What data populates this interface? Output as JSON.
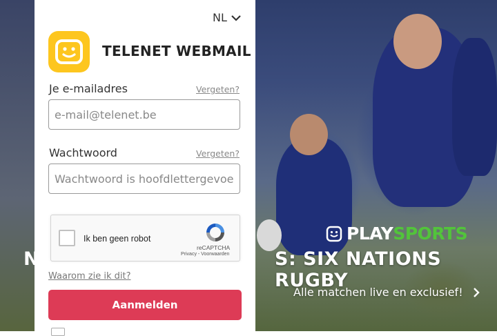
{
  "language": {
    "selected": "NL"
  },
  "brand": {
    "name": "TELENET WEBMAIL",
    "color": "#fdc61f"
  },
  "email": {
    "label": "Je e-mailadres",
    "forgot": "Vergeten?",
    "placeholder": "e-mail@telenet.be"
  },
  "password": {
    "label": "Wachtwoord",
    "forgot": "Vergeten?",
    "placeholder": "Wachtwoord is hoofdlettergevoelig"
  },
  "recaptcha": {
    "checkbox_label": "Ik ben geen robot",
    "brand": "reCAPTCHA",
    "links": "Privacy - Voorwaarden"
  },
  "why_link": "Waarom zie ik dit?",
  "login_button": {
    "label": "Aanmelden",
    "color": "#dd3b56"
  },
  "promo": {
    "logo_play": "PLAY",
    "logo_sports": "SPORTS",
    "headline_left": "N",
    "headline": "S: SIX NATIONS RUGBY",
    "subtitle": "Alle matchen live en exclusief!",
    "accent_color": "#52c43b"
  }
}
